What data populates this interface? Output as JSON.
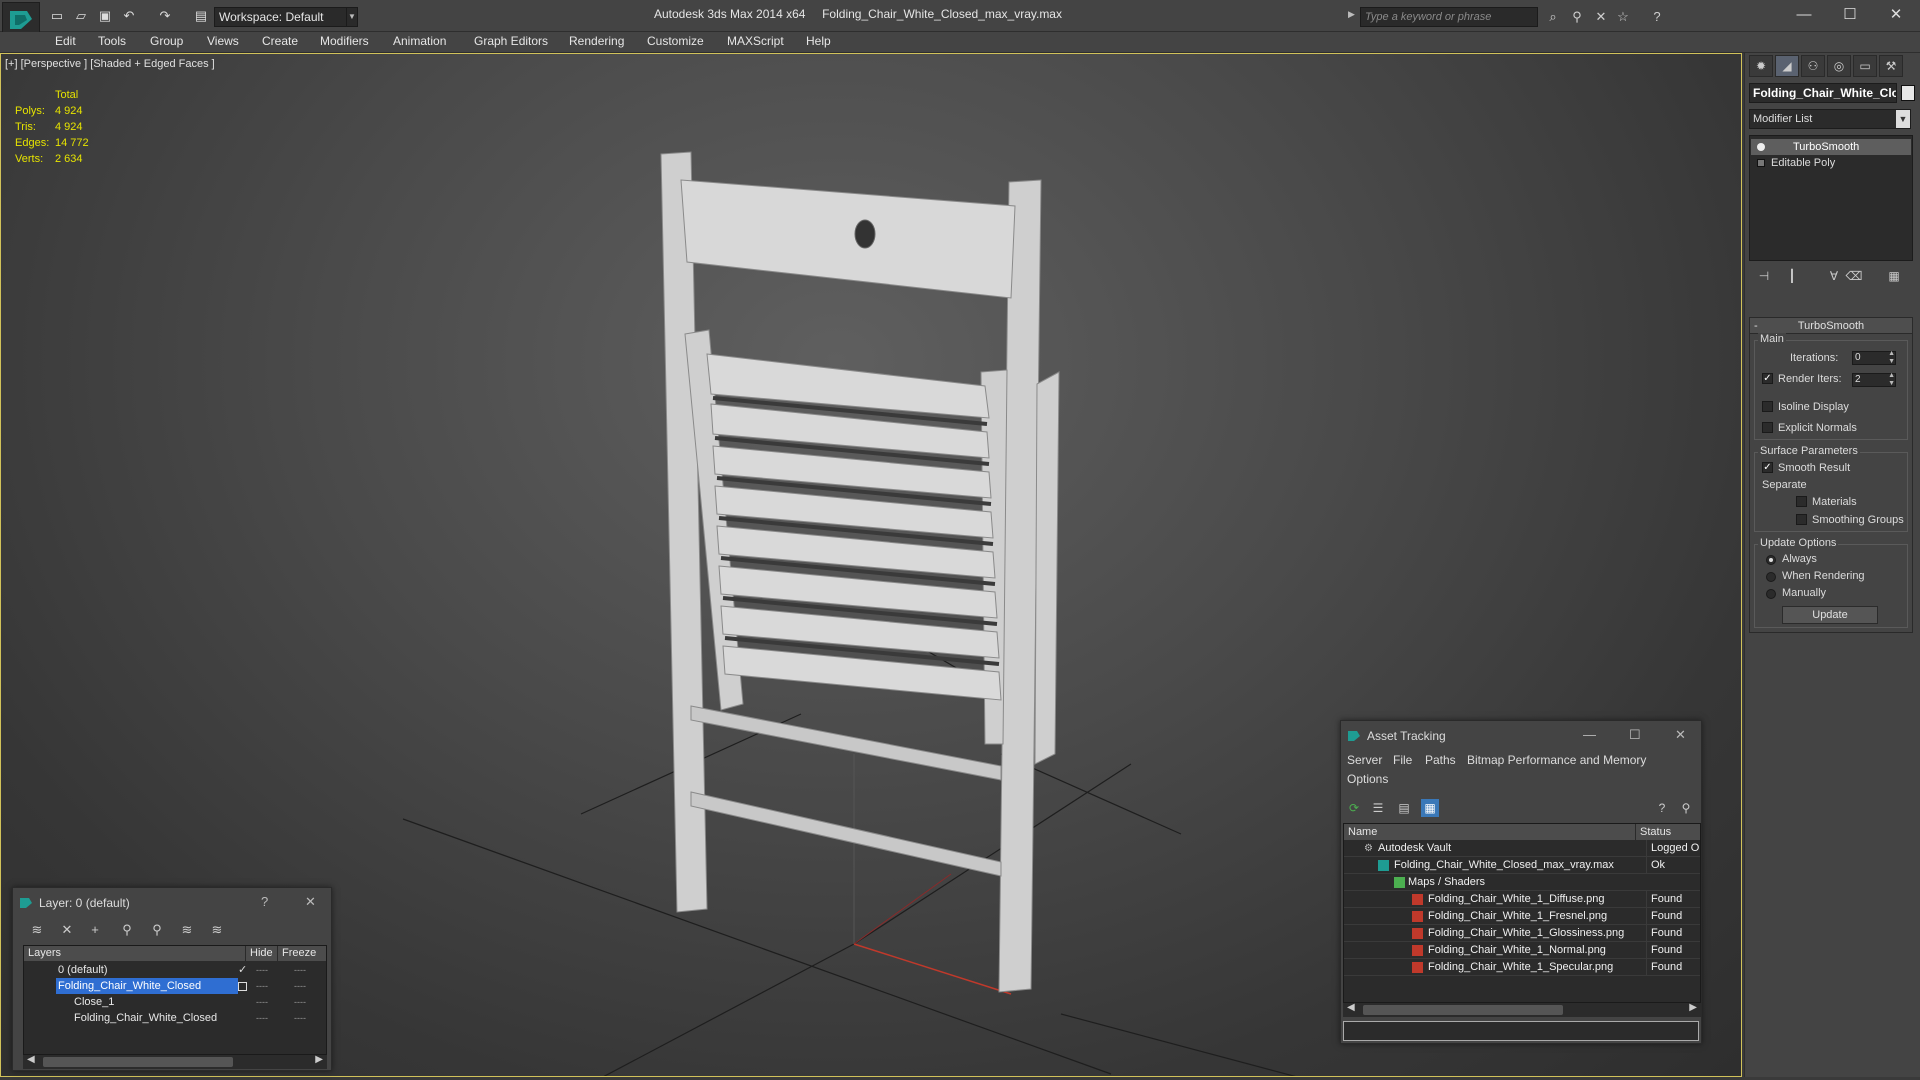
{
  "app": {
    "title": "Autodesk 3ds Max 2014 x64     Folding_Chair_White_Closed_max_vray.max",
    "workspace": "Workspace: Default",
    "search_placeholder": "Type a keyword or phrase"
  },
  "menu": [
    "Edit",
    "Tools",
    "Group",
    "Views",
    "Create",
    "Modifiers",
    "Animation",
    "Graph Editors",
    "Rendering",
    "Customize",
    "MAXScript",
    "Help"
  ],
  "viewport": {
    "label": "[+] [Perspective ] [Shaded + Edged Faces ]",
    "stats": {
      "header": "Total",
      "rows": [
        {
          "label": "Polys:",
          "value": "4 924"
        },
        {
          "label": "Tris:",
          "value": "4 924"
        },
        {
          "label": "Edges:",
          "value": "14 772"
        },
        {
          "label": "Verts:",
          "value": "2 634"
        }
      ]
    }
  },
  "command_panel": {
    "object_name": "Folding_Chair_White_Clo",
    "modifier_list": "Modifier List",
    "stack": [
      "TurboSmooth",
      "Editable Poly"
    ],
    "rollout_title": "TurboSmooth",
    "main_group": "Main",
    "iterations_label": "Iterations:",
    "iterations_value": "0",
    "render_iters_label": "Render Iters:",
    "render_iters_value": "2",
    "isoline_label": "Isoline Display",
    "explicit_label": "Explicit Normals",
    "surface_group": "Surface Parameters",
    "smooth_result_label": "Smooth Result",
    "separate_label": "Separate",
    "materials_label": "Materials",
    "smoothing_label": "Smoothing Groups",
    "update_group": "Update Options",
    "radio_always": "Always",
    "radio_rendering": "When Rendering",
    "radio_manually": "Manually",
    "update_button": "Update"
  },
  "asset_tracking": {
    "title": "Asset Tracking",
    "menu1": [
      "Server",
      "File",
      "Paths",
      "Bitmap Performance and Memory"
    ],
    "menu2": [
      "Options"
    ],
    "col_name": "Name",
    "col_status": "Status",
    "rows": [
      {
        "name": "Autodesk Vault",
        "status": "Logged Ou"
      },
      {
        "name": "Folding_Chair_White_Closed_max_vray.max",
        "status": "Ok"
      },
      {
        "name": "Maps / Shaders",
        "status": ""
      },
      {
        "name": "Folding_Chair_White_1_Diffuse.png",
        "status": "Found"
      },
      {
        "name": "Folding_Chair_White_1_Fresnel.png",
        "status": "Found"
      },
      {
        "name": "Folding_Chair_White_1_Glossiness.png",
        "status": "Found"
      },
      {
        "name": "Folding_Chair_White_1_Normal.png",
        "status": "Found"
      },
      {
        "name": "Folding_Chair_White_1_Specular.png",
        "status": "Found"
      }
    ]
  },
  "layer_window": {
    "title": "Layer: 0 (default)",
    "help": "?",
    "col_layers": "Layers",
    "col_hide": "Hide",
    "col_freeze": "Freeze",
    "rows": [
      {
        "name": "0 (default)"
      },
      {
        "name": "Folding_Chair_White_Closed"
      },
      {
        "name": "Close_1"
      },
      {
        "name": "Folding_Chair_White_Closed"
      }
    ]
  },
  "colors": {
    "stats_yellow": "#e6e300",
    "selection_blue": "#2f6ed2",
    "viewport_border": "#d1c25a"
  }
}
